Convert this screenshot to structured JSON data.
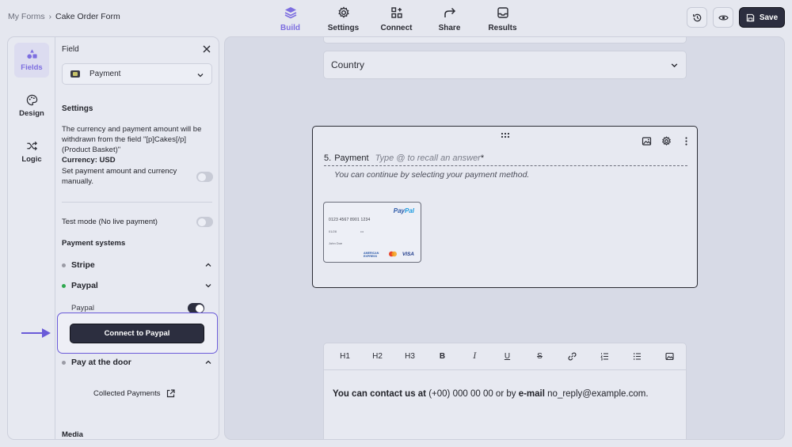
{
  "breadcrumb": {
    "parent": "My Forms",
    "separator": "›",
    "current": "Cake Order Form"
  },
  "nav": {
    "tabs": [
      {
        "label": "Build",
        "icon": "layers-icon",
        "active": true
      },
      {
        "label": "Settings",
        "icon": "gear-icon",
        "active": false
      },
      {
        "label": "Connect",
        "icon": "connect-icon",
        "active": false
      },
      {
        "label": "Share",
        "icon": "share-icon",
        "active": false
      },
      {
        "label": "Results",
        "icon": "inbox-icon",
        "active": false
      }
    ]
  },
  "toolbar": {
    "save_label": "Save",
    "history_icon": "history-icon",
    "preview_icon": "eye-icon"
  },
  "rail": {
    "items": [
      {
        "label": "Fields",
        "icon": "shapes-icon",
        "active": true
      },
      {
        "label": "Design",
        "icon": "palette-icon",
        "active": false
      },
      {
        "label": "Logic",
        "icon": "shuffle-icon",
        "active": false
      }
    ]
  },
  "field_panel": {
    "title": "Field",
    "field_type": "Payment",
    "settings_heading": "Settings",
    "settings_desc": "The currency and payment amount will be withdrawn from the field \"[p]Cakes[/p] (Product Basket)\"",
    "currency": "Currency: USD",
    "manual_label": "Set payment amount and currency manually.",
    "manual_on": false,
    "test_mode_label": "Test mode (No live payment)",
    "test_mode_on": false,
    "payment_systems_heading": "Payment systems",
    "providers": [
      {
        "name": "Stripe",
        "status": "inactive",
        "expanded": true
      },
      {
        "name": "Paypal",
        "status": "active",
        "expanded": false
      },
      {
        "name": "Pay at the door",
        "status": "inactive",
        "expanded": true
      }
    ],
    "paypal_toggle_label": "Paypal",
    "paypal_on": true,
    "connect_button": "Connect to Paypal",
    "collected_payments": "Collected Payments",
    "media_heading": "Media"
  },
  "canvas": {
    "country_placeholder": "Country",
    "question": {
      "number": "5.",
      "label": "Payment",
      "placeholder": "Type @ to recall an answer",
      "required_mark": "*",
      "description": "You can continue by selecting your payment method."
    },
    "card_preview": {
      "brand": "Pay",
      "brand_suffix": "Pal",
      "number": "0123 4567 8901 1234",
      "expiry": "01/28",
      "cvv": "•••",
      "owner": "John Doe",
      "amex": "AMERICAN EXPRESS",
      "visa": "VISA"
    },
    "editor": {
      "tools": [
        "H1",
        "H2",
        "H3",
        "B",
        "I",
        "U",
        "S",
        "link",
        "ordered-list",
        "bullet-list",
        "image"
      ],
      "content_parts": [
        {
          "text": "You can contact us at",
          "bold": true
        },
        {
          "text": " (+00) 000 00 00 or by ",
          "bold": false
        },
        {
          "text": "e-mail",
          "bold": true
        },
        {
          "text": " no_reply@example.com.",
          "bold": false
        }
      ]
    }
  },
  "colors": {
    "accent": "#7d6ee0",
    "dark": "#2c2e3f",
    "highlight_border": "#6a5ad8",
    "active_dot": "#2ea84e"
  }
}
